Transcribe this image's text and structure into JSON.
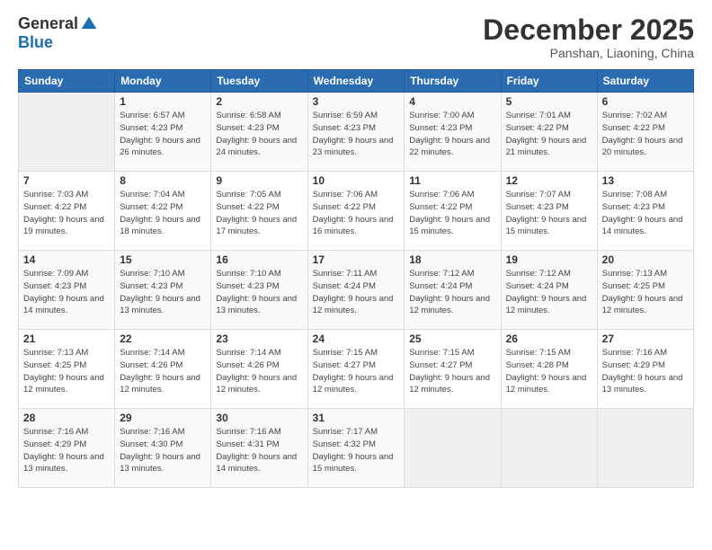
{
  "logo": {
    "general": "General",
    "blue": "Blue"
  },
  "header": {
    "month": "December 2025",
    "location": "Panshan, Liaoning, China"
  },
  "days_of_week": [
    "Sunday",
    "Monday",
    "Tuesday",
    "Wednesday",
    "Thursday",
    "Friday",
    "Saturday"
  ],
  "weeks": [
    [
      {
        "day": "",
        "sunrise": "",
        "sunset": "",
        "daylight": ""
      },
      {
        "day": "1",
        "sunrise": "Sunrise: 6:57 AM",
        "sunset": "Sunset: 4:23 PM",
        "daylight": "Daylight: 9 hours and 26 minutes."
      },
      {
        "day": "2",
        "sunrise": "Sunrise: 6:58 AM",
        "sunset": "Sunset: 4:23 PM",
        "daylight": "Daylight: 9 hours and 24 minutes."
      },
      {
        "day": "3",
        "sunrise": "Sunrise: 6:59 AM",
        "sunset": "Sunset: 4:23 PM",
        "daylight": "Daylight: 9 hours and 23 minutes."
      },
      {
        "day": "4",
        "sunrise": "Sunrise: 7:00 AM",
        "sunset": "Sunset: 4:23 PM",
        "daylight": "Daylight: 9 hours and 22 minutes."
      },
      {
        "day": "5",
        "sunrise": "Sunrise: 7:01 AM",
        "sunset": "Sunset: 4:22 PM",
        "daylight": "Daylight: 9 hours and 21 minutes."
      },
      {
        "day": "6",
        "sunrise": "Sunrise: 7:02 AM",
        "sunset": "Sunset: 4:22 PM",
        "daylight": "Daylight: 9 hours and 20 minutes."
      }
    ],
    [
      {
        "day": "7",
        "sunrise": "Sunrise: 7:03 AM",
        "sunset": "Sunset: 4:22 PM",
        "daylight": "Daylight: 9 hours and 19 minutes."
      },
      {
        "day": "8",
        "sunrise": "Sunrise: 7:04 AM",
        "sunset": "Sunset: 4:22 PM",
        "daylight": "Daylight: 9 hours and 18 minutes."
      },
      {
        "day": "9",
        "sunrise": "Sunrise: 7:05 AM",
        "sunset": "Sunset: 4:22 PM",
        "daylight": "Daylight: 9 hours and 17 minutes."
      },
      {
        "day": "10",
        "sunrise": "Sunrise: 7:06 AM",
        "sunset": "Sunset: 4:22 PM",
        "daylight": "Daylight: 9 hours and 16 minutes."
      },
      {
        "day": "11",
        "sunrise": "Sunrise: 7:06 AM",
        "sunset": "Sunset: 4:22 PM",
        "daylight": "Daylight: 9 hours and 15 minutes."
      },
      {
        "day": "12",
        "sunrise": "Sunrise: 7:07 AM",
        "sunset": "Sunset: 4:23 PM",
        "daylight": "Daylight: 9 hours and 15 minutes."
      },
      {
        "day": "13",
        "sunrise": "Sunrise: 7:08 AM",
        "sunset": "Sunset: 4:23 PM",
        "daylight": "Daylight: 9 hours and 14 minutes."
      }
    ],
    [
      {
        "day": "14",
        "sunrise": "Sunrise: 7:09 AM",
        "sunset": "Sunset: 4:23 PM",
        "daylight": "Daylight: 9 hours and 14 minutes."
      },
      {
        "day": "15",
        "sunrise": "Sunrise: 7:10 AM",
        "sunset": "Sunset: 4:23 PM",
        "daylight": "Daylight: 9 hours and 13 minutes."
      },
      {
        "day": "16",
        "sunrise": "Sunrise: 7:10 AM",
        "sunset": "Sunset: 4:23 PM",
        "daylight": "Daylight: 9 hours and 13 minutes."
      },
      {
        "day": "17",
        "sunrise": "Sunrise: 7:11 AM",
        "sunset": "Sunset: 4:24 PM",
        "daylight": "Daylight: 9 hours and 12 minutes."
      },
      {
        "day": "18",
        "sunrise": "Sunrise: 7:12 AM",
        "sunset": "Sunset: 4:24 PM",
        "daylight": "Daylight: 9 hours and 12 minutes."
      },
      {
        "day": "19",
        "sunrise": "Sunrise: 7:12 AM",
        "sunset": "Sunset: 4:24 PM",
        "daylight": "Daylight: 9 hours and 12 minutes."
      },
      {
        "day": "20",
        "sunrise": "Sunrise: 7:13 AM",
        "sunset": "Sunset: 4:25 PM",
        "daylight": "Daylight: 9 hours and 12 minutes."
      }
    ],
    [
      {
        "day": "21",
        "sunrise": "Sunrise: 7:13 AM",
        "sunset": "Sunset: 4:25 PM",
        "daylight": "Daylight: 9 hours and 12 minutes."
      },
      {
        "day": "22",
        "sunrise": "Sunrise: 7:14 AM",
        "sunset": "Sunset: 4:26 PM",
        "daylight": "Daylight: 9 hours and 12 minutes."
      },
      {
        "day": "23",
        "sunrise": "Sunrise: 7:14 AM",
        "sunset": "Sunset: 4:26 PM",
        "daylight": "Daylight: 9 hours and 12 minutes."
      },
      {
        "day": "24",
        "sunrise": "Sunrise: 7:15 AM",
        "sunset": "Sunset: 4:27 PM",
        "daylight": "Daylight: 9 hours and 12 minutes."
      },
      {
        "day": "25",
        "sunrise": "Sunrise: 7:15 AM",
        "sunset": "Sunset: 4:27 PM",
        "daylight": "Daylight: 9 hours and 12 minutes."
      },
      {
        "day": "26",
        "sunrise": "Sunrise: 7:15 AM",
        "sunset": "Sunset: 4:28 PM",
        "daylight": "Daylight: 9 hours and 12 minutes."
      },
      {
        "day": "27",
        "sunrise": "Sunrise: 7:16 AM",
        "sunset": "Sunset: 4:29 PM",
        "daylight": "Daylight: 9 hours and 13 minutes."
      }
    ],
    [
      {
        "day": "28",
        "sunrise": "Sunrise: 7:16 AM",
        "sunset": "Sunset: 4:29 PM",
        "daylight": "Daylight: 9 hours and 13 minutes."
      },
      {
        "day": "29",
        "sunrise": "Sunrise: 7:16 AM",
        "sunset": "Sunset: 4:30 PM",
        "daylight": "Daylight: 9 hours and 13 minutes."
      },
      {
        "day": "30",
        "sunrise": "Sunrise: 7:16 AM",
        "sunset": "Sunset: 4:31 PM",
        "daylight": "Daylight: 9 hours and 14 minutes."
      },
      {
        "day": "31",
        "sunrise": "Sunrise: 7:17 AM",
        "sunset": "Sunset: 4:32 PM",
        "daylight": "Daylight: 9 hours and 15 minutes."
      },
      {
        "day": "",
        "sunrise": "",
        "sunset": "",
        "daylight": ""
      },
      {
        "day": "",
        "sunrise": "",
        "sunset": "",
        "daylight": ""
      },
      {
        "day": "",
        "sunrise": "",
        "sunset": "",
        "daylight": ""
      }
    ]
  ]
}
